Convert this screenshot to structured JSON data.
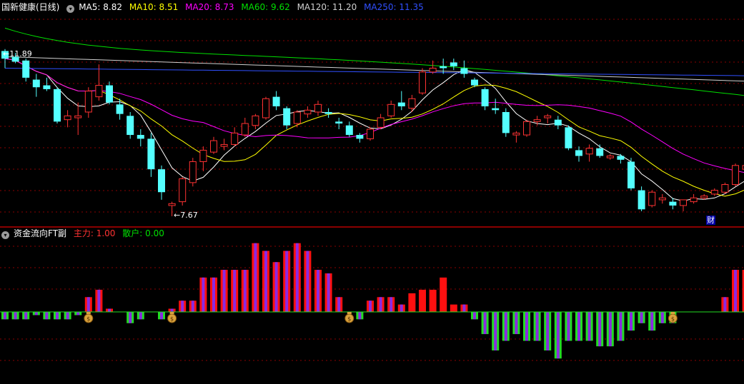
{
  "main": {
    "title": "国新健康(日线)",
    "ma": [
      {
        "label": "MA5: 8.82",
        "color": "#ffffff"
      },
      {
        "label": "MA10: 8.51",
        "color": "#ffff00"
      },
      {
        "label": "MA20: 8.73",
        "color": "#ff00ff"
      },
      {
        "label": "MA60: 9.62",
        "color": "#00e000"
      },
      {
        "label": "MA120: 11.20",
        "color": "#d0d0d0"
      },
      {
        "label": "MA250: 11.35",
        "color": "#3050ff"
      }
    ],
    "high_label": "11.89",
    "low_label": "7.67",
    "fin_marker": "财"
  },
  "sub": {
    "title": "资金流向FT副",
    "main_force": "主力: 1.00",
    "retail": "散户: 0.00"
  },
  "colors": {
    "up": "#ff3232",
    "down": "#54ffff",
    "bg": "#000000",
    "grid": "#8b0000"
  },
  "chart_data": [
    {
      "type": "candlestick",
      "low_annotation": 7.67,
      "high_annotation": 11.89,
      "candles": [
        [
          12.0,
          12.05,
          11.55,
          11.8
        ],
        [
          11.85,
          11.95,
          11.68,
          11.72
        ],
        [
          11.75,
          11.8,
          11.2,
          11.3
        ],
        [
          11.25,
          11.4,
          10.8,
          11.05
        ],
        [
          11.1,
          11.3,
          10.95,
          11.0
        ],
        [
          11.0,
          11.05,
          10.1,
          10.15
        ],
        [
          10.2,
          10.45,
          10.0,
          10.3
        ],
        [
          10.25,
          10.65,
          9.8,
          10.3
        ],
        [
          10.4,
          11.05,
          10.25,
          10.95
        ],
        [
          10.8,
          11.65,
          10.7,
          11.1
        ],
        [
          11.1,
          11.2,
          10.6,
          10.65
        ],
        [
          10.6,
          10.75,
          10.2,
          10.35
        ],
        [
          10.3,
          10.4,
          9.7,
          9.8
        ],
        [
          9.8,
          9.95,
          9.5,
          9.7
        ],
        [
          9.7,
          9.85,
          8.7,
          8.9
        ],
        [
          8.9,
          9.0,
          8.1,
          8.3
        ],
        [
          7.95,
          8.05,
          7.67,
          8.0
        ],
        [
          8.05,
          8.7,
          7.95,
          8.65
        ],
        [
          8.55,
          9.2,
          8.45,
          9.1
        ],
        [
          9.1,
          9.5,
          8.85,
          9.4
        ],
        [
          9.35,
          9.75,
          9.3,
          9.65
        ],
        [
          9.5,
          9.7,
          9.4,
          9.55
        ],
        [
          9.55,
          10.0,
          9.5,
          9.85
        ],
        [
          9.8,
          10.25,
          9.75,
          10.1
        ],
        [
          10.05,
          10.35,
          9.95,
          10.3
        ],
        [
          10.25,
          10.8,
          10.2,
          10.75
        ],
        [
          10.8,
          10.95,
          10.45,
          10.55
        ],
        [
          10.5,
          10.55,
          9.95,
          10.05
        ],
        [
          10.1,
          10.45,
          10.0,
          10.4
        ],
        [
          10.35,
          10.55,
          10.25,
          10.45
        ],
        [
          10.4,
          10.7,
          10.3,
          10.6
        ],
        [
          10.4,
          10.5,
          10.25,
          10.35
        ],
        [
          10.15,
          10.25,
          9.95,
          10.1
        ],
        [
          10.05,
          10.15,
          9.75,
          9.8
        ],
        [
          9.8,
          9.85,
          9.6,
          9.7
        ],
        [
          9.7,
          10.0,
          9.65,
          9.95
        ],
        [
          10.0,
          10.35,
          9.95,
          10.25
        ],
        [
          10.3,
          10.7,
          10.25,
          10.6
        ],
        [
          10.65,
          10.95,
          10.45,
          10.55
        ],
        [
          10.5,
          10.85,
          10.4,
          10.75
        ],
        [
          10.9,
          11.55,
          10.85,
          11.45
        ],
        [
          11.45,
          11.75,
          11.4,
          11.55
        ],
        [
          11.6,
          11.8,
          11.4,
          11.55
        ],
        [
          11.7,
          11.8,
          11.5,
          11.6
        ],
        [
          11.55,
          11.75,
          11.3,
          11.4
        ],
        [
          11.25,
          11.3,
          11.05,
          11.1
        ],
        [
          11.0,
          11.05,
          10.45,
          10.55
        ],
        [
          10.5,
          10.75,
          10.35,
          10.45
        ],
        [
          10.4,
          10.5,
          9.75,
          9.85
        ],
        [
          9.8,
          9.9,
          9.6,
          9.85
        ],
        [
          9.8,
          10.2,
          9.75,
          10.15
        ],
        [
          10.15,
          10.3,
          10.05,
          10.2
        ],
        [
          10.25,
          10.35,
          10.1,
          10.3
        ],
        [
          10.2,
          10.3,
          9.95,
          10.05
        ],
        [
          10.0,
          10.05,
          9.4,
          9.45
        ],
        [
          9.4,
          9.5,
          9.1,
          9.25
        ],
        [
          9.3,
          9.55,
          9.1,
          9.45
        ],
        [
          9.45,
          9.55,
          9.2,
          9.25
        ],
        [
          9.2,
          9.3,
          9.15,
          9.25
        ],
        [
          9.25,
          9.3,
          9.05,
          9.15
        ],
        [
          9.1,
          9.2,
          8.35,
          8.4
        ],
        [
          8.35,
          8.45,
          7.8,
          7.85
        ],
        [
          7.95,
          8.35,
          7.9,
          8.3
        ],
        [
          8.1,
          8.25,
          8.0,
          8.15
        ],
        [
          8.05,
          8.15,
          7.85,
          7.95
        ],
        [
          7.95,
          8.05,
          7.8,
          8.1
        ],
        [
          8.05,
          8.25,
          8.0,
          8.15
        ],
        [
          8.15,
          8.25,
          8.1,
          8.2
        ],
        [
          8.25,
          8.4,
          8.2,
          8.35
        ],
        [
          8.3,
          8.55,
          8.25,
          8.5
        ],
        [
          8.5,
          9.05,
          8.45,
          9.0
        ],
        [
          8.9,
          9.15,
          8.85,
          9.0
        ],
        [
          9.0,
          9.2,
          8.95,
          9.05
        ]
      ]
    },
    {
      "type": "bar",
      "name": "资金流向FT副",
      "values": [
        -0.23,
        -0.23,
        -0.23,
        -0.1,
        -0.23,
        -0.23,
        -0.23,
        -0.1,
        0.46,
        0.69,
        0.1,
        0,
        -0.35,
        -0.23,
        0,
        -0.23,
        0.1,
        0.35,
        0.35,
        1.07,
        1.07,
        1.31,
        1.31,
        1.31,
        2.14,
        1.9,
        1.55,
        1.9,
        2.14,
        1.9,
        1.31,
        1.2,
        0.46,
        0,
        -0.23,
        0.35,
        0.46,
        0.46,
        0.23,
        0.58,
        0.69,
        0.69,
        1.07,
        0.23,
        0.23,
        -0.23,
        -0.69,
        -1.2,
        -0.9,
        -0.69,
        -0.9,
        -0.9,
        -1.2,
        -1.45,
        -0.9,
        -0.9,
        -0.9,
        -1.07,
        -1.07,
        -0.9,
        -0.58,
        -0.35,
        -0.58,
        -0.35,
        -0.35,
        0,
        0,
        0,
        0,
        0.46,
        1.31,
        1.31,
        1.31,
        1.55
      ],
      "money_bag_indices": [
        8,
        16,
        33,
        64
      ]
    }
  ]
}
